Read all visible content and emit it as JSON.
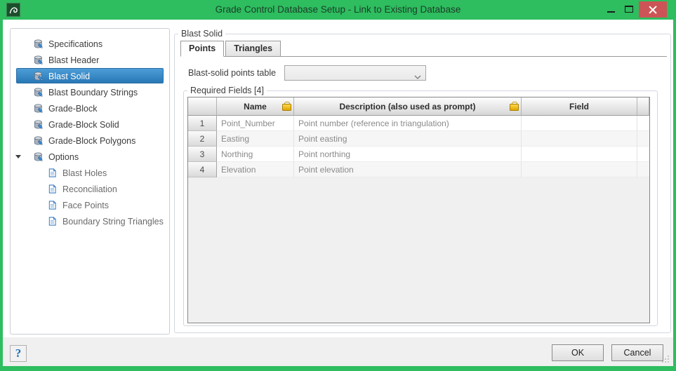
{
  "window": {
    "title": "Grade Control Database Setup - Link to Existing Database"
  },
  "sidebar": {
    "items": [
      {
        "label": "Specifications"
      },
      {
        "label": "Blast Header"
      },
      {
        "label": "Blast Solid",
        "selected": true
      },
      {
        "label": "Blast Boundary Strings"
      },
      {
        "label": "Grade-Block"
      },
      {
        "label": "Grade-Block Solid"
      },
      {
        "label": "Grade-Block Polygons"
      },
      {
        "label": "Options",
        "expander": true
      },
      {
        "label": "Blast Holes",
        "child": true
      },
      {
        "label": "Reconciliation",
        "child": true
      },
      {
        "label": "Face Points",
        "child": true
      },
      {
        "label": "Boundary String Triangles",
        "child": true
      }
    ]
  },
  "main": {
    "group_label": "Blast Solid",
    "tabs": [
      {
        "label": "Points",
        "active": true
      },
      {
        "label": "Triangles"
      }
    ],
    "points_table_field": {
      "label": "Blast-solid points table",
      "value": ""
    },
    "required_fields": {
      "group_label": "Required Fields [4]",
      "columns": [
        {
          "label": ""
        },
        {
          "label": "Name",
          "lock": true
        },
        {
          "label": "Description (also used as prompt)",
          "lock": true
        },
        {
          "label": "Field"
        },
        {
          "label": ""
        }
      ],
      "rows": [
        {
          "num": "1",
          "name": "Point_Number",
          "description": "Point number (reference in triangulation)",
          "field": ""
        },
        {
          "num": "2",
          "name": "Easting",
          "description": "Point easting",
          "field": ""
        },
        {
          "num": "3",
          "name": "Northing",
          "description": "Point northing",
          "field": ""
        },
        {
          "num": "4",
          "name": "Elevation",
          "description": "Point elevation",
          "field": ""
        }
      ]
    }
  },
  "footer": {
    "help_label": "?",
    "ok_label": "OK",
    "cancel_label": "Cancel"
  },
  "colors": {
    "titlebar_green": "#2ebd5f",
    "title_text": "#1c3c28",
    "close_red": "#cd5456",
    "selection_blue": "#2f86c6",
    "lock_gold": "#e8b400",
    "help_blue": "#1a6fb5",
    "footer_gray": "#f0f0f0"
  }
}
